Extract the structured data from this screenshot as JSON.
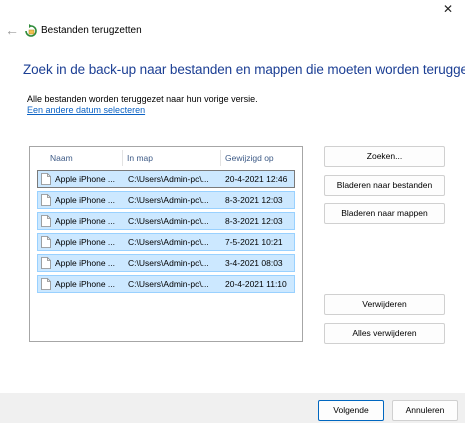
{
  "window": {
    "title": "Bestanden terugzetten",
    "close_label": "✕"
  },
  "heading": "Zoek in de back-up naar bestanden en mappen die moeten worden teruggezet",
  "info_text": "Alle bestanden worden teruggezet naar hun vorige versie.",
  "date_link": "Een andere datum selecteren",
  "list": {
    "columns": [
      "Naam",
      "In map",
      "Gewijzigd op"
    ],
    "rows": [
      {
        "name": "Apple iPhone ...",
        "folder": "C:\\Users\\Admin-pc\\...",
        "modified": "20-4-2021 12:46"
      },
      {
        "name": "Apple iPhone ...",
        "folder": "C:\\Users\\Admin-pc\\...",
        "modified": "8-3-2021 12:03"
      },
      {
        "name": "Apple iPhone ...",
        "folder": "C:\\Users\\Admin-pc\\...",
        "modified": "8-3-2021 12:03"
      },
      {
        "name": "Apple iPhone ...",
        "folder": "C:\\Users\\Admin-pc\\...",
        "modified": "7-5-2021 10:21"
      },
      {
        "name": "Apple iPhone ...",
        "folder": "C:\\Users\\Admin-pc\\...",
        "modified": "3-4-2021 08:03"
      },
      {
        "name": "Apple iPhone ...",
        "folder": "C:\\Users\\Admin-pc\\...",
        "modified": "20-4-2021 11:10"
      }
    ]
  },
  "buttons": {
    "search": "Zoeken...",
    "browse_files": "Bladeren naar bestanden",
    "browse_folders": "Bladeren naar mappen",
    "remove": "Verwijderen",
    "remove_all": "Alles verwijderen",
    "next": "Volgende",
    "cancel": "Annuleren"
  },
  "colors": {
    "heading": "#1c3f94",
    "link": "#0b62c4",
    "row_selected": "#cce8ff"
  }
}
